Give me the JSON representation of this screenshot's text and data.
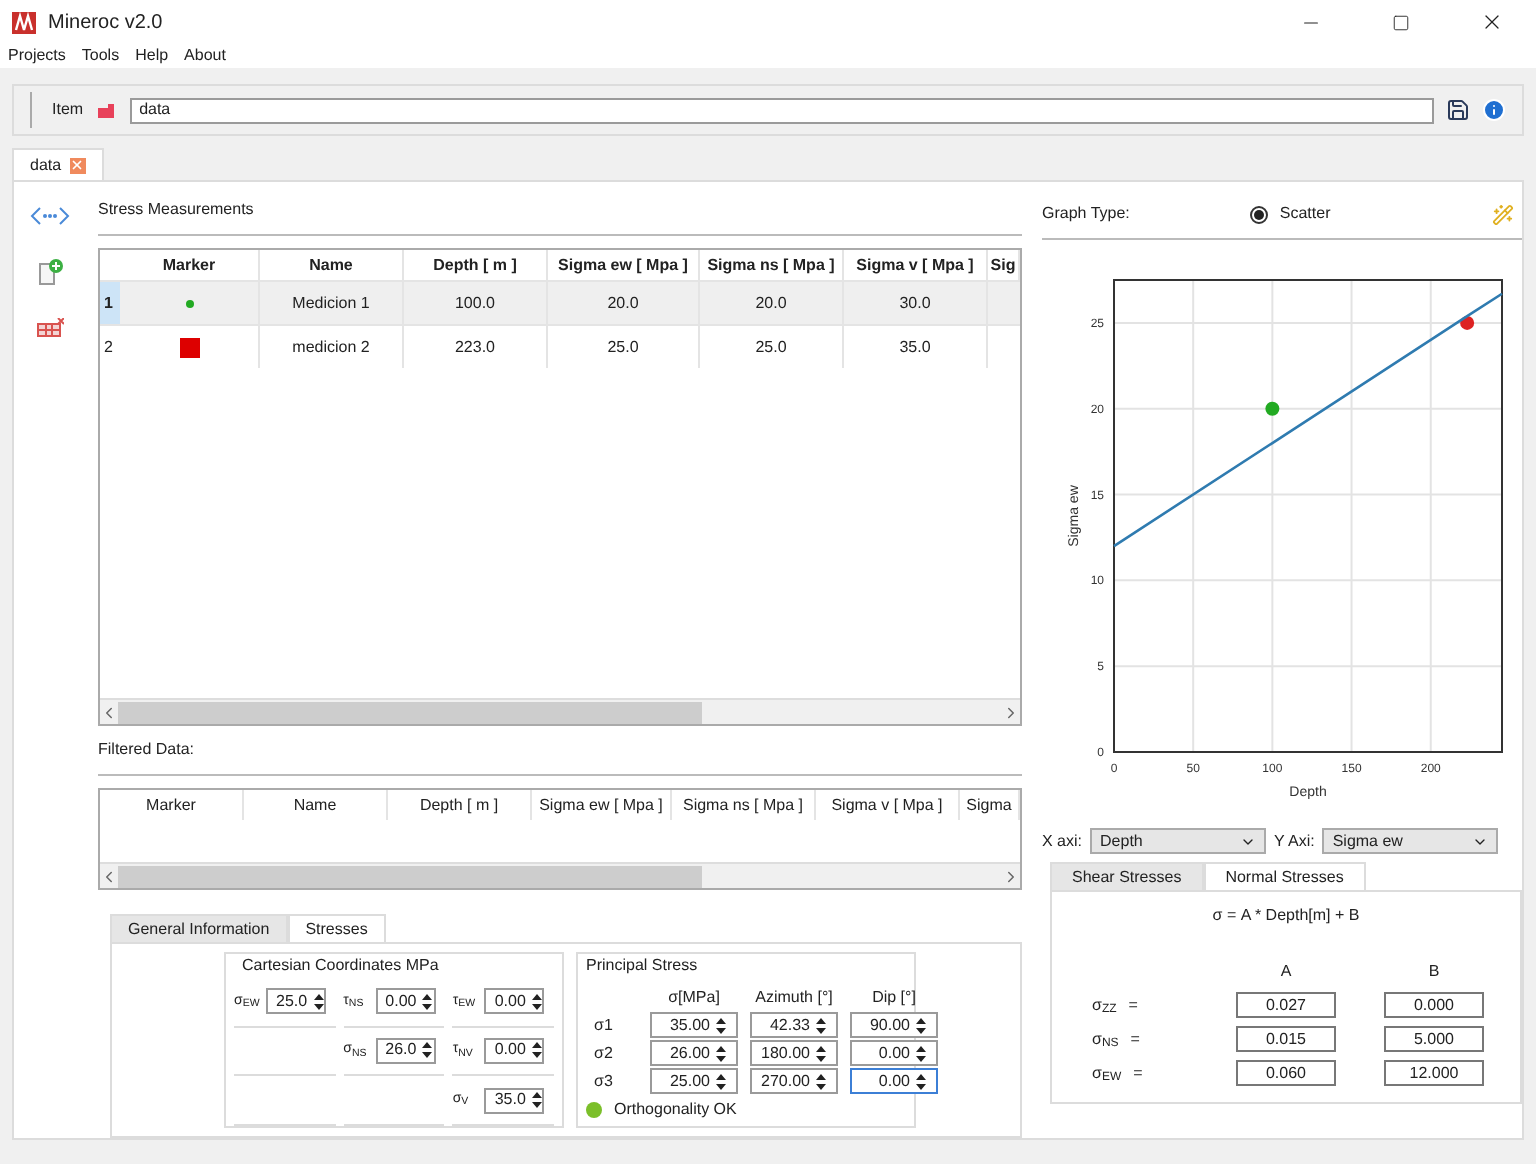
{
  "window": {
    "title": "Mineroc v2.0"
  },
  "menu": [
    "Projects",
    "Tools",
    "Help",
    "About"
  ],
  "toolbar": {
    "label": "Item",
    "value": "data"
  },
  "tabs": [
    {
      "label": "data",
      "selected": true
    }
  ],
  "measurements": {
    "title": "Stress Measurements",
    "marker_header": "Marker",
    "columns": [
      "Name",
      "Depth [ m ]",
      "Sigma ew [ Mpa ]",
      "Sigma ns [ Mpa ]",
      "Sigma v [ Mpa ]",
      "Sig"
    ],
    "rows": [
      {
        "number": "1",
        "selected": true,
        "marker": {
          "kind": "dot",
          "color": "#22aa22"
        },
        "cells": [
          "Medicion 1",
          "100.0",
          "20.0",
          "20.0",
          "30.0"
        ]
      },
      {
        "number": "2",
        "selected": false,
        "marker": {
          "kind": "square",
          "color": "#dd0000"
        },
        "cells": [
          "medicion 2",
          "223.0",
          "25.0",
          "25.0",
          "35.0"
        ]
      }
    ]
  },
  "filtered": {
    "title": "Filtered Data:",
    "columns": [
      "Marker",
      "Name",
      "Depth [ m ]",
      "Sigma ew [ Mpa ]",
      "Sigma ns [ Mpa ]",
      "Sigma v [ Mpa ]",
      "Sigma"
    ]
  },
  "detail_tabs": [
    {
      "label": "General Information",
      "selected": false
    },
    {
      "label": "Stresses",
      "selected": true
    }
  ],
  "cartesian": {
    "title": "Cartesian Coordinates MPa",
    "rows": [
      [
        {
          "kind": "spin",
          "label": "σ$_{EW}$",
          "value": "25.0"
        },
        {
          "kind": "spin",
          "label": "τ$_{NS}$",
          "value": "0.00"
        },
        {
          "kind": "spin",
          "label": "τ$_{EW}$",
          "value": "0.00"
        }
      ],
      [
        {
          "kind": "empty"
        },
        {
          "kind": "spin",
          "label": "σ$_{NS}$",
          "value": "26.0"
        },
        {
          "kind": "spin",
          "label": "τ$_{NV}$",
          "value": "0.00"
        }
      ],
      [
        {
          "kind": "empty"
        },
        {
          "kind": "empty"
        },
        {
          "kind": "spin",
          "label": "σ$_{V}$",
          "value": "35.0"
        }
      ]
    ]
  },
  "principal": {
    "title": "Principal Stress",
    "columns": [
      "σ[MPa]",
      "Azimuth [°]",
      "Dip [°]"
    ],
    "rows": [
      {
        "label": "σ1",
        "values": [
          {
            "text": "35.00",
            "focused": false
          },
          {
            "text": "42.33",
            "focused": false
          },
          {
            "text": "90.00",
            "focused": false
          }
        ]
      },
      {
        "label": "σ2",
        "values": [
          {
            "text": "26.00",
            "focused": false
          },
          {
            "text": "180.00",
            "focused": false
          },
          {
            "text": "0.00",
            "focused": false
          }
        ]
      },
      {
        "label": "σ3",
        "values": [
          {
            "text": "25.00",
            "focused": false
          },
          {
            "text": "270.00",
            "focused": false
          },
          {
            "text": "0.00",
            "focused": true
          }
        ]
      }
    ],
    "status": {
      "text": "Orthogonality OK",
      "ok": true
    }
  },
  "graph": {
    "label": "Graph Type:",
    "option": {
      "label": "Scatter",
      "selected": true
    },
    "chart_data": {
      "type": "scatter",
      "xlabel": "Depth",
      "ylabel": "Sigma ew",
      "x": [
        0,
        100,
        223,
        245
      ],
      "series": [
        {
          "type": "scatter",
          "color": "#22aa22",
          "values": [
            null,
            20,
            null,
            null
          ]
        },
        {
          "type": "scatter",
          "color": "#dd2222",
          "values": [
            null,
            null,
            25,
            null
          ]
        },
        {
          "type": "line",
          "color": "#2f7bb0",
          "values": [
            12,
            18,
            25.4,
            26.7
          ]
        }
      ],
      "xlim": [
        0,
        245
      ],
      "ylim": [
        0,
        27.5
      ],
      "xticks": [
        0,
        50,
        100,
        150,
        200
      ],
      "yticks": [
        0,
        5,
        10,
        15,
        20,
        25
      ],
      "grid": true
    },
    "x_axis": {
      "label": "X axi:",
      "value": "Depth"
    },
    "y_axis": {
      "label": "Y Axi:",
      "value": "Sigma ew"
    }
  },
  "regression_tabs": [
    {
      "label": "Shear Stresses",
      "selected": false
    },
    {
      "label": "Normal Stresses",
      "selected": true
    }
  ],
  "regression": {
    "formula": "σ = A * Depth[m] + B",
    "columns": [
      "A",
      "B"
    ],
    "rows": [
      {
        "label": "σ$_{ZZ}$",
        "sign": "=",
        "values": [
          "0.027",
          "0.000"
        ]
      },
      {
        "label": "σ$_{NS}$",
        "sign": "=",
        "values": [
          "0.015",
          "5.000"
        ]
      },
      {
        "label": "σ$_{EW}$",
        "sign": "=",
        "values": [
          "0.060",
          "12.000"
        ]
      }
    ]
  }
}
